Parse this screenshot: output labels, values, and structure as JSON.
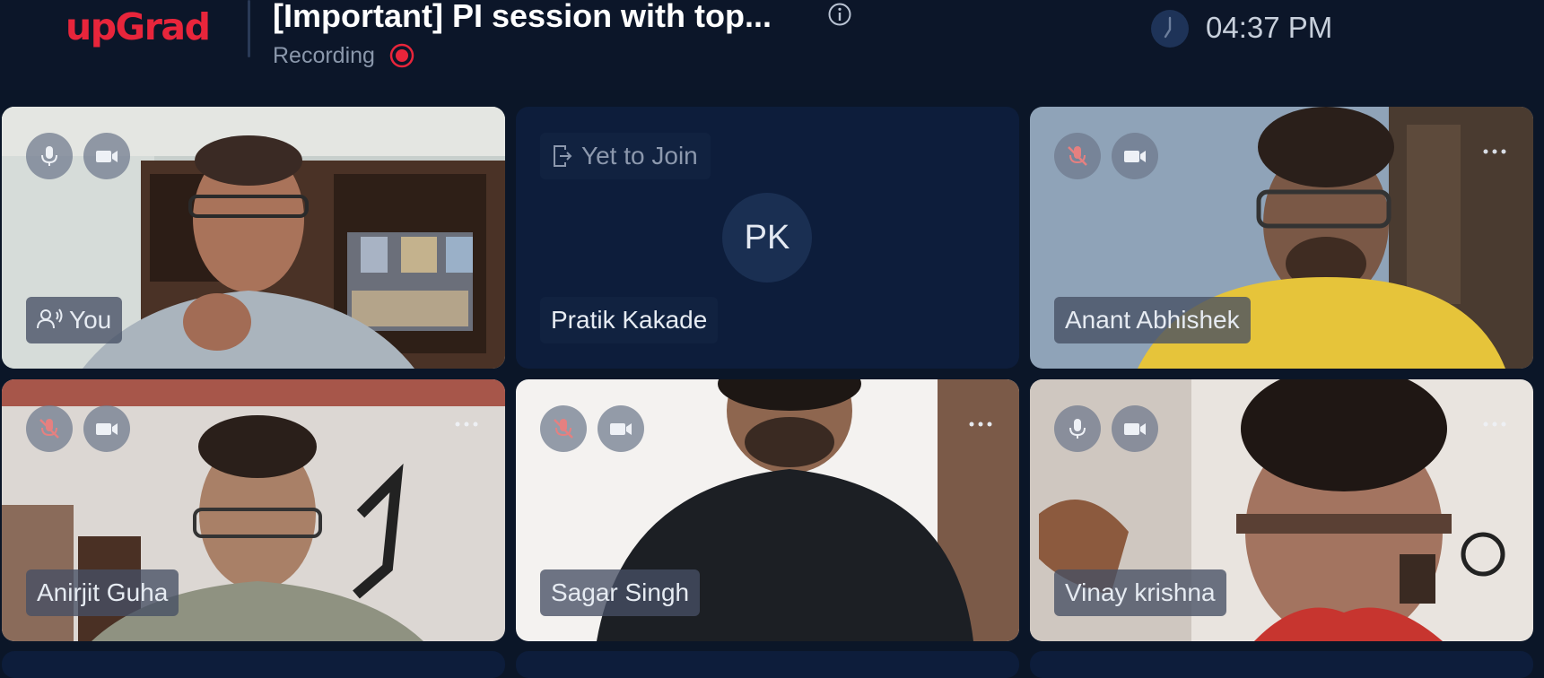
{
  "header": {
    "logo_text": "upGrad",
    "logo_color": "#e8253b",
    "title": "[Important] PI session with top...",
    "recording_label": "Recording",
    "recording_color": "#e8253b",
    "time": "04:37 PM",
    "icons": [
      "info-icon",
      "recording-dot-icon",
      "clock-icon"
    ]
  },
  "tiles": [
    {
      "name": "You",
      "type": "video",
      "mic": "on",
      "camera": "on",
      "speaker_icon": true
    },
    {
      "name": "Pratik Kakade",
      "type": "pending",
      "status": "Yet to Join",
      "initials": "PK"
    },
    {
      "name": "Anant Abhishek",
      "type": "video",
      "mic": "muted",
      "camera": "on",
      "more_menu": true
    },
    {
      "name": "Anirjit Guha",
      "type": "video",
      "mic": "muted",
      "camera": "on",
      "more_menu": true
    },
    {
      "name": "Sagar Singh",
      "type": "video",
      "mic": "muted",
      "camera": "on",
      "more_menu": true
    },
    {
      "name": "Vinay krishna",
      "type": "video",
      "mic": "on",
      "camera": "on",
      "more_menu": true
    }
  ],
  "colors": {
    "background": "#0b1628",
    "tile_pending": "#0d1d3b",
    "muted_icon": "#e58080"
  }
}
